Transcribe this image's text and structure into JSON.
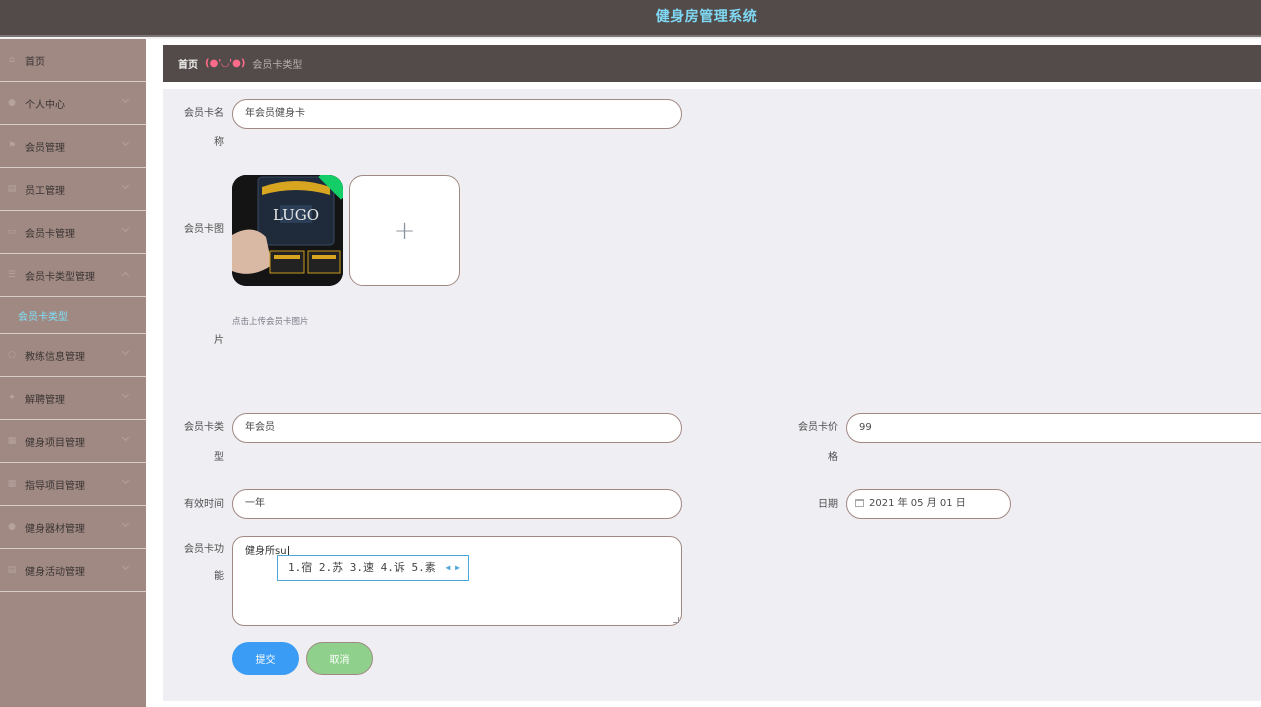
{
  "app": {
    "title": "健身房管理系统"
  },
  "sidebar": {
    "items": [
      {
        "label": "首页",
        "icon": "home-icon"
      },
      {
        "label": "个人中心",
        "icon": "user-icon"
      },
      {
        "label": "会员管理",
        "icon": "flag-icon"
      },
      {
        "label": "员工管理",
        "icon": "list-icon"
      },
      {
        "label": "会员卡管理",
        "icon": "card-icon"
      },
      {
        "label": "会员卡类型管理",
        "icon": "menu-icon"
      },
      {
        "label": "教练信息管理",
        "icon": "circle-icon"
      },
      {
        "label": "解聘管理",
        "icon": "star-icon"
      },
      {
        "label": "健身项目管理",
        "icon": "doc-icon"
      },
      {
        "label": "指导项目管理",
        "icon": "doc-icon"
      },
      {
        "label": "健身器材管理",
        "icon": "user-icon"
      },
      {
        "label": "健身活动管理",
        "icon": "list-icon"
      }
    ],
    "active_submenu": "会员卡类型"
  },
  "breadcrumb": {
    "home": "首页",
    "separator": "(●'◡'●)",
    "current": "会员卡类型"
  },
  "form": {
    "card_name": {
      "label_line1": "会员卡名",
      "label_line2": "称",
      "value": "年会员健身卡"
    },
    "card_image": {
      "label_line1": "会员卡图",
      "label_line2": "片",
      "tip": "点击上传会员卡图片",
      "upload_plus": "+"
    },
    "card_type": {
      "label_line1": "会员卡类",
      "label_line2": "型",
      "value": "年会员"
    },
    "card_price": {
      "label_line1": "会员卡价",
      "label_line2": "格",
      "value": "99"
    },
    "validity": {
      "label": "有效时间",
      "value": "一年"
    },
    "date": {
      "label": "日期",
      "value": "2021 年 05 月 01 日"
    },
    "card_function": {
      "label_line1": "会员卡功",
      "label_line2": "能",
      "value": "健身所su"
    },
    "ime": {
      "candidates": "1.宿 2.苏 3.速 4.诉 5.素"
    },
    "submit_label": "提交",
    "cancel_label": "取消"
  },
  "colors": {
    "topbar": "#524b49",
    "sidebar": "#a08983",
    "title": "#7fd8f4",
    "submit": "#3b9cf5",
    "cancel": "#8fd18c"
  }
}
